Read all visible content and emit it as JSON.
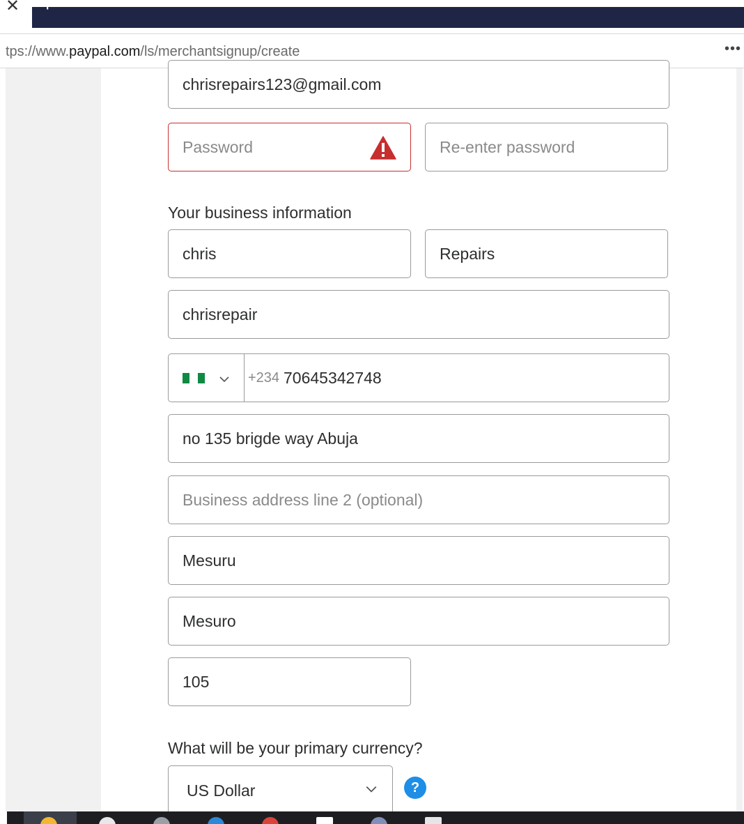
{
  "browser": {
    "close_glyph": "✕",
    "new_tab_glyph": "+",
    "url_prefix": "tps://www.",
    "url_domain": "paypal.com",
    "url_path": "/ls/merchantsignup/create",
    "menu_glyph": "•••"
  },
  "form": {
    "email_value": "chrisrepairs123@gmail.com",
    "password_placeholder": "Password",
    "reenter_password_placeholder": "Re-enter password",
    "business_info_label": "Your business information",
    "first_name_value": "chris",
    "last_name_value": "Repairs",
    "business_name_value": "chrisrepair",
    "phone_prefix": "+234",
    "phone_value": "70645342748",
    "address_line1_value": "no 135 brigde way Abuja",
    "address_line2_placeholder": "Business address line 2 (optional)",
    "city_value": "Mesuru",
    "state_value": "Mesuro",
    "postal_code_value": "105",
    "currency_label": "What will be your primary currency?",
    "currency_value": "US Dollar",
    "help_glyph": "?"
  },
  "colors": {
    "error_border": "#c72e2e",
    "help_blue": "#1e8ee6",
    "nigeria_green": "#0f8a43",
    "tab_dark": "#1f2544"
  },
  "icons": {
    "password_error": "warning-triangle-icon",
    "country_dropdown": "chevron-down-icon",
    "currency_dropdown": "chevron-down-icon",
    "currency_help": "question-circle-icon"
  }
}
